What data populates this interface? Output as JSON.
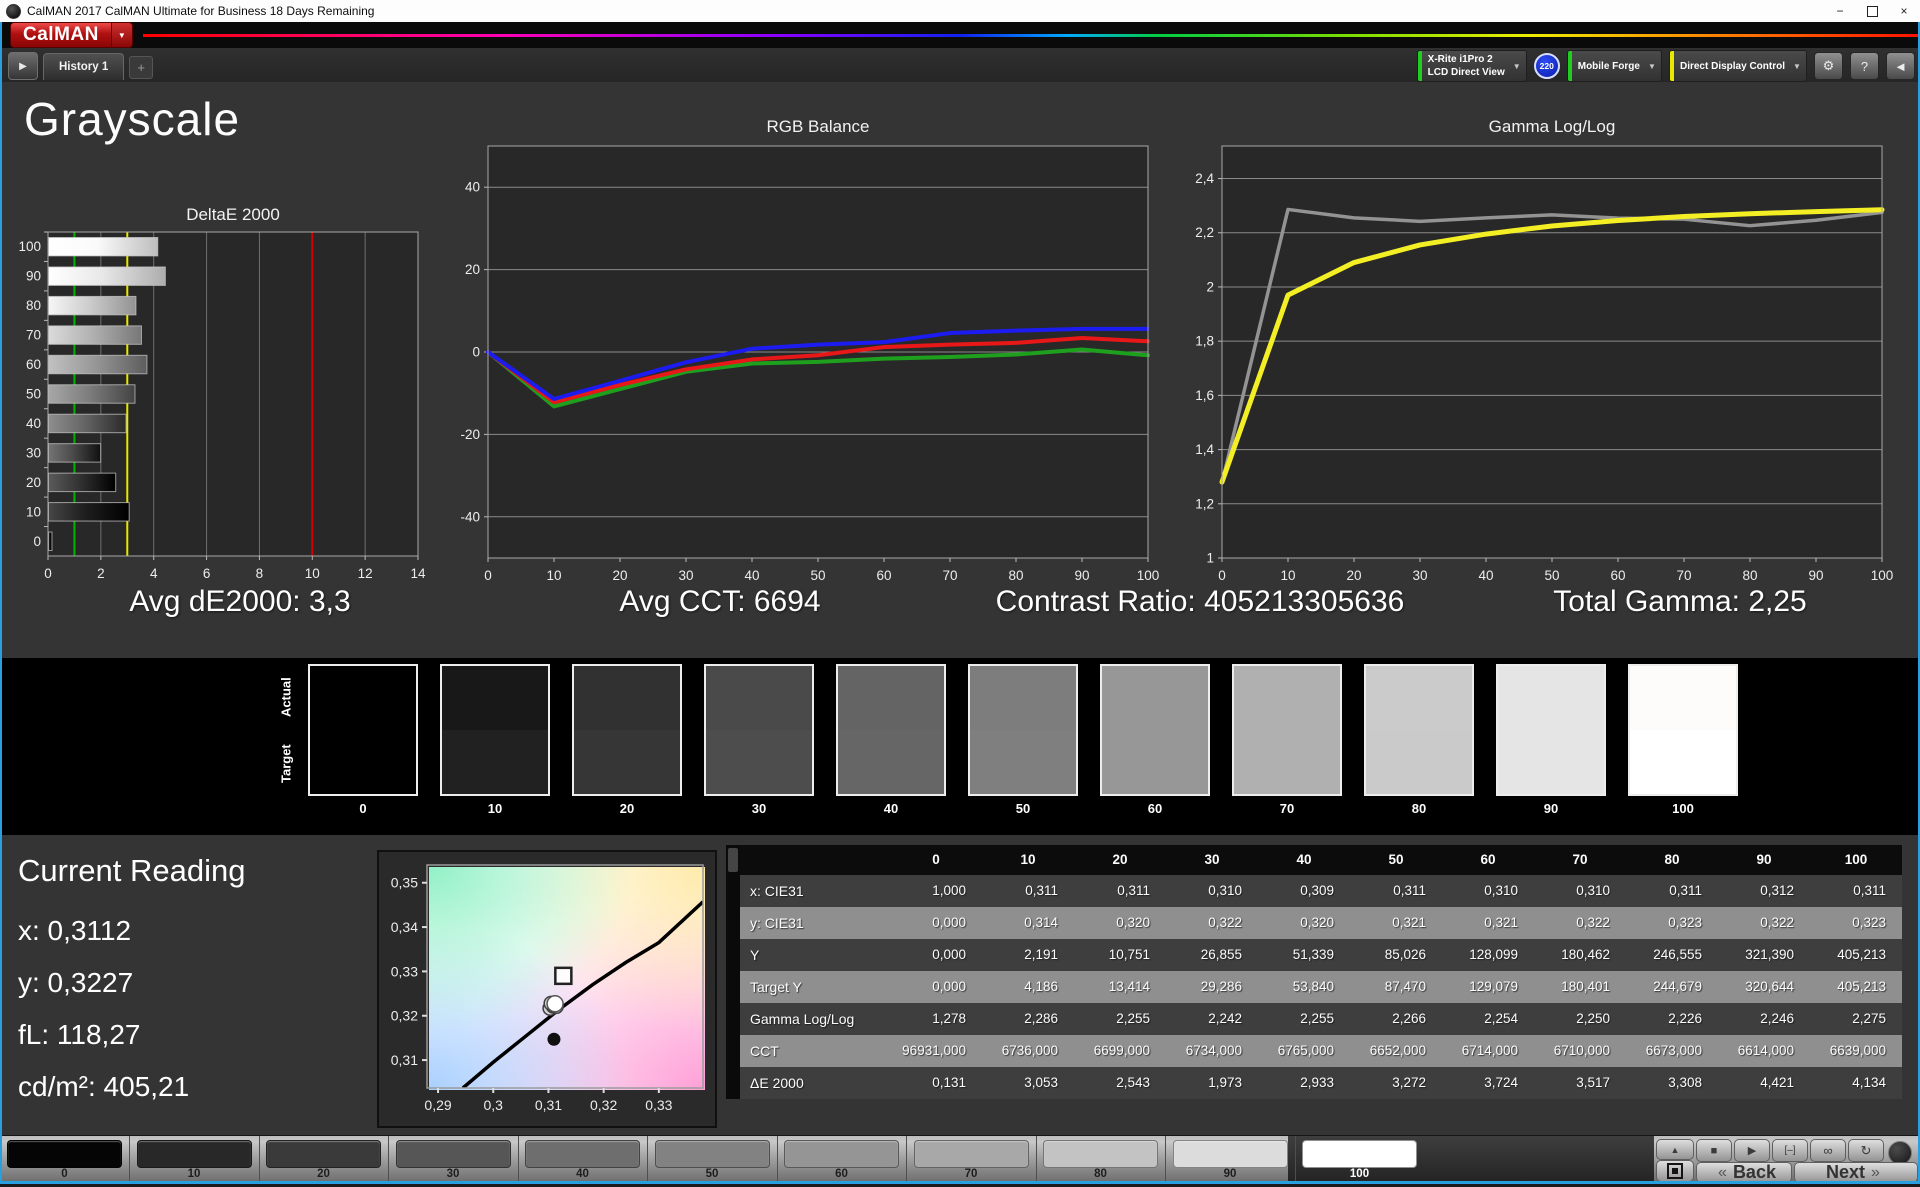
{
  "window": {
    "title": "CalMAN 2017 CalMAN Ultimate for Business 18 Days Remaining"
  },
  "brand": {
    "logo": "CalMAN"
  },
  "tabs": {
    "history": "History 1",
    "add": "+"
  },
  "toolbar": {
    "meter_line1": "X-Rite i1Pro 2",
    "meter_line2": "LCD Direct View",
    "meter_badge": "220",
    "meter_accent": "#22cc22",
    "source_label": "Mobile Forge",
    "source_accent": "#22cc22",
    "control_label": "Direct Display Control",
    "control_accent": "#e8e800"
  },
  "icons": {
    "chevron_down": "▼",
    "play": "▶",
    "gear": "⚙",
    "help": "?",
    "collapse_left": "◄",
    "minimize": "−",
    "close": "×",
    "up": "▲",
    "stop": "■",
    "single_measure": "[–]",
    "loop": "∞",
    "refresh": "↻",
    "back_chevrons": "«",
    "next_chevrons": "»"
  },
  "page_title": "Grayscale",
  "summary": [
    {
      "label": "Avg dE2000:",
      "value": "3,3"
    },
    {
      "label": "Avg CCT:",
      "value": "6694"
    },
    {
      "label": "Contrast Ratio:",
      "value": "405213305636"
    },
    {
      "label": "Total Gamma:",
      "value": "2,25"
    }
  ],
  "chart_data": [
    {
      "type": "bar",
      "title": "DeltaE 2000",
      "orientation": "horizontal",
      "categories": [
        "100",
        "90",
        "80",
        "70",
        "60",
        "50",
        "40",
        "30",
        "20",
        "10",
        "0"
      ],
      "values": [
        4.134,
        4.421,
        3.308,
        3.517,
        3.724,
        3.272,
        2.933,
        1.973,
        2.543,
        3.053,
        0.131
      ],
      "bar_colors": [
        "#fafafa",
        "#e9e9e9",
        "#cecece",
        "#b3b3b3",
        "#999999",
        "#7f7f7f",
        "#666666",
        "#4c4c4c",
        "#333333",
        "#1e1e1e",
        "#0d0d0d"
      ],
      "xlim": [
        0,
        14
      ],
      "xticks": [
        0,
        2,
        4,
        6,
        8,
        10,
        12,
        14
      ],
      "grid": true,
      "reference_lines": [
        {
          "value": 1,
          "color": "#00b400"
        },
        {
          "value": 3,
          "color": "#e8e800"
        },
        {
          "value": 10,
          "color": "#d40000"
        }
      ]
    },
    {
      "type": "line",
      "title": "RGB Balance",
      "x": [
        0,
        10,
        20,
        30,
        40,
        50,
        60,
        70,
        80,
        90,
        100
      ],
      "xtick_labels": [
        "0",
        "10",
        "20",
        "30",
        "40",
        "50",
        "60",
        "70",
        "80",
        "90",
        "100"
      ],
      "ylim": [
        -50,
        50
      ],
      "yticks": [
        {
          "v": 40,
          "label": "40"
        },
        {
          "v": 20,
          "label": "20"
        },
        {
          "v": 0,
          "label": "0"
        },
        {
          "v": -20,
          "label": "-20"
        },
        {
          "v": -40,
          "label": "-40"
        }
      ],
      "grid": "horizontal",
      "series": [
        {
          "name": "Green",
          "color": "#1ea01e",
          "width": 4,
          "values": [
            0,
            -13.2,
            -9,
            -4.8,
            -2.8,
            -2.4,
            -1.6,
            -1.2,
            -0.6,
            0.6,
            -0.8
          ]
        },
        {
          "name": "Red",
          "color": "#e81818",
          "width": 4,
          "values": [
            0,
            -12.2,
            -8,
            -4.2,
            -1.8,
            -0.8,
            1.2,
            1.8,
            2.2,
            3.4,
            2.6
          ]
        },
        {
          "name": "Blue",
          "color": "#1c1cf0",
          "width": 4,
          "values": [
            0,
            -11.4,
            -7,
            -2.5,
            0.8,
            1.8,
            2.4,
            4.6,
            5.2,
            5.6,
            5.6
          ]
        }
      ]
    },
    {
      "type": "line",
      "title": "Gamma Log/Log",
      "x": [
        0,
        10,
        20,
        30,
        40,
        50,
        60,
        70,
        80,
        90,
        100
      ],
      "xtick_labels": [
        "0",
        "10",
        "20",
        "30",
        "40",
        "50",
        "60",
        "70",
        "80",
        "90",
        "100"
      ],
      "ylim": [
        1,
        2.52
      ],
      "yticks": [
        {
          "v": 2.4,
          "label": "2,4"
        },
        {
          "v": 2.2,
          "label": "2,2"
        },
        {
          "v": 2,
          "label": "2"
        },
        {
          "v": 1.8,
          "label": "1,8"
        },
        {
          "v": 1.6,
          "label": "1,6"
        },
        {
          "v": 1.4,
          "label": "1,4"
        },
        {
          "v": 1.2,
          "label": "1,2"
        },
        {
          "v": 1,
          "label": "1"
        }
      ],
      "grid": "horizontal",
      "series": [
        {
          "name": "Measured Gamma",
          "color": "#939393",
          "width": 3.5,
          "values": [
            1.278,
            2.286,
            2.255,
            2.242,
            2.255,
            2.266,
            2.254,
            2.25,
            2.226,
            2.246,
            2.275
          ]
        },
        {
          "name": "Target Gamma",
          "color": "#f3ef24",
          "width": 5,
          "values": [
            1.28,
            1.97,
            2.09,
            2.155,
            2.195,
            2.225,
            2.245,
            2.26,
            2.27,
            2.278,
            2.285
          ]
        }
      ]
    },
    {
      "type": "scatter",
      "title": "CIE 1931 xy",
      "xlim": [
        0.288,
        0.338
      ],
      "ylim": [
        0.3037,
        0.354
      ],
      "xticks": [
        {
          "v": 0.29,
          "label": "0,29"
        },
        {
          "v": 0.3,
          "label": "0,3"
        },
        {
          "v": 0.31,
          "label": "0,31"
        },
        {
          "v": 0.32,
          "label": "0,32"
        },
        {
          "v": 0.33,
          "label": "0,33"
        }
      ],
      "yticks": [
        {
          "v": 0.35,
          "label": "0,35"
        },
        {
          "v": 0.34,
          "label": "0,34"
        },
        {
          "v": 0.33,
          "label": "0,33"
        },
        {
          "v": 0.32,
          "label": "0,32"
        },
        {
          "v": 0.31,
          "label": "0,31"
        }
      ],
      "locus": [
        [
          0.2945,
          0.3037
        ],
        [
          0.3,
          0.3095
        ],
        [
          0.306,
          0.3155
        ],
        [
          0.312,
          0.3215
        ],
        [
          0.318,
          0.327
        ],
        [
          0.324,
          0.332
        ],
        [
          0.33,
          0.3365
        ],
        [
          0.338,
          0.3457
        ]
      ],
      "target_point": {
        "x": 0.3127,
        "y": 0.329,
        "shape": "square"
      },
      "measured_points": [
        [
          0.3103,
          0.3217
        ],
        [
          0.3109,
          0.3222
        ],
        [
          0.3105,
          0.3228
        ],
        [
          0.3114,
          0.3221
        ]
      ],
      "current_point": {
        "x": 0.3112,
        "y": 0.3227
      },
      "dark_point": {
        "x": 0.311,
        "y": 0.3147
      }
    }
  ],
  "swatch_row": {
    "row_labels": [
      "Actual",
      "Target"
    ],
    "levels": [
      "0",
      "10",
      "20",
      "30",
      "40",
      "50",
      "60",
      "70",
      "80",
      "90",
      "100"
    ],
    "actual_colors": [
      "#000000",
      "#181818",
      "#313131",
      "#4a4a4a",
      "#646464",
      "#7d7d7d",
      "#979797",
      "#b0b0b0",
      "#cbcbcb",
      "#e5e5e5",
      "#fefcfa"
    ],
    "target_colors": [
      "#000000",
      "#212121",
      "#363636",
      "#4d4d4d",
      "#666666",
      "#7f7f7f",
      "#979797",
      "#b0b0b0",
      "#cacaca",
      "#e5e5e5",
      "#ffffff"
    ]
  },
  "current_reading": {
    "title": "Current Reading",
    "values": [
      {
        "label": "x:",
        "value": "0,3112"
      },
      {
        "label": "y:",
        "value": "0,3227"
      },
      {
        "label": "fL:",
        "value": "118,27"
      },
      {
        "label": "cd/m²:",
        "value": "405,21"
      }
    ]
  },
  "table": {
    "columns": [
      "0",
      "10",
      "20",
      "30",
      "40",
      "50",
      "60",
      "70",
      "80",
      "90",
      "100"
    ],
    "rows": [
      {
        "label": "x: CIE31",
        "values": [
          "1,000",
          "0,311",
          "0,311",
          "0,310",
          "0,309",
          "0,311",
          "0,310",
          "0,310",
          "0,311",
          "0,312",
          "0,311"
        ]
      },
      {
        "label": "y: CIE31",
        "values": [
          "0,000",
          "0,314",
          "0,320",
          "0,322",
          "0,320",
          "0,321",
          "0,321",
          "0,322",
          "0,323",
          "0,322",
          "0,323"
        ]
      },
      {
        "label": "Y",
        "values": [
          "0,000",
          "2,191",
          "10,751",
          "26,855",
          "51,339",
          "85,026",
          "128,099",
          "180,462",
          "246,555",
          "321,390",
          "405,213"
        ]
      },
      {
        "label": "Target Y",
        "values": [
          "0,000",
          "4,186",
          "13,414",
          "29,286",
          "53,840",
          "87,470",
          "129,079",
          "180,401",
          "244,679",
          "320,644",
          "405,213"
        ]
      },
      {
        "label": "Gamma Log/Log",
        "values": [
          "1,278",
          "2,286",
          "2,255",
          "2,242",
          "2,255",
          "2,266",
          "2,254",
          "2,250",
          "2,226",
          "2,246",
          "2,275"
        ]
      },
      {
        "label": "CCT",
        "values": [
          "96931,000",
          "6736,000",
          "6699,000",
          "6734,000",
          "6765,000",
          "6652,000",
          "6714,000",
          "6710,000",
          "6673,000",
          "6614,000",
          "6639,000"
        ]
      },
      {
        "label": "ΔE 2000",
        "values": [
          "0,131",
          "3,053",
          "2,543",
          "1,973",
          "2,933",
          "3,272",
          "3,724",
          "3,517",
          "3,308",
          "4,421",
          "4,134"
        ]
      }
    ]
  },
  "bottom_bar": {
    "levels": [
      "0",
      "10",
      "20",
      "30",
      "40",
      "50",
      "60",
      "70",
      "80",
      "90",
      "100"
    ],
    "colors": [
      "#050505",
      "#282828",
      "#3a3a3a",
      "#565656",
      "#6e6e6e",
      "#828282",
      "#959595",
      "#a8a8a8",
      "#c3c3c3",
      "#dcdcdc",
      "#ffffff"
    ],
    "selected_index": 10,
    "back": "Back",
    "next": "Next"
  }
}
